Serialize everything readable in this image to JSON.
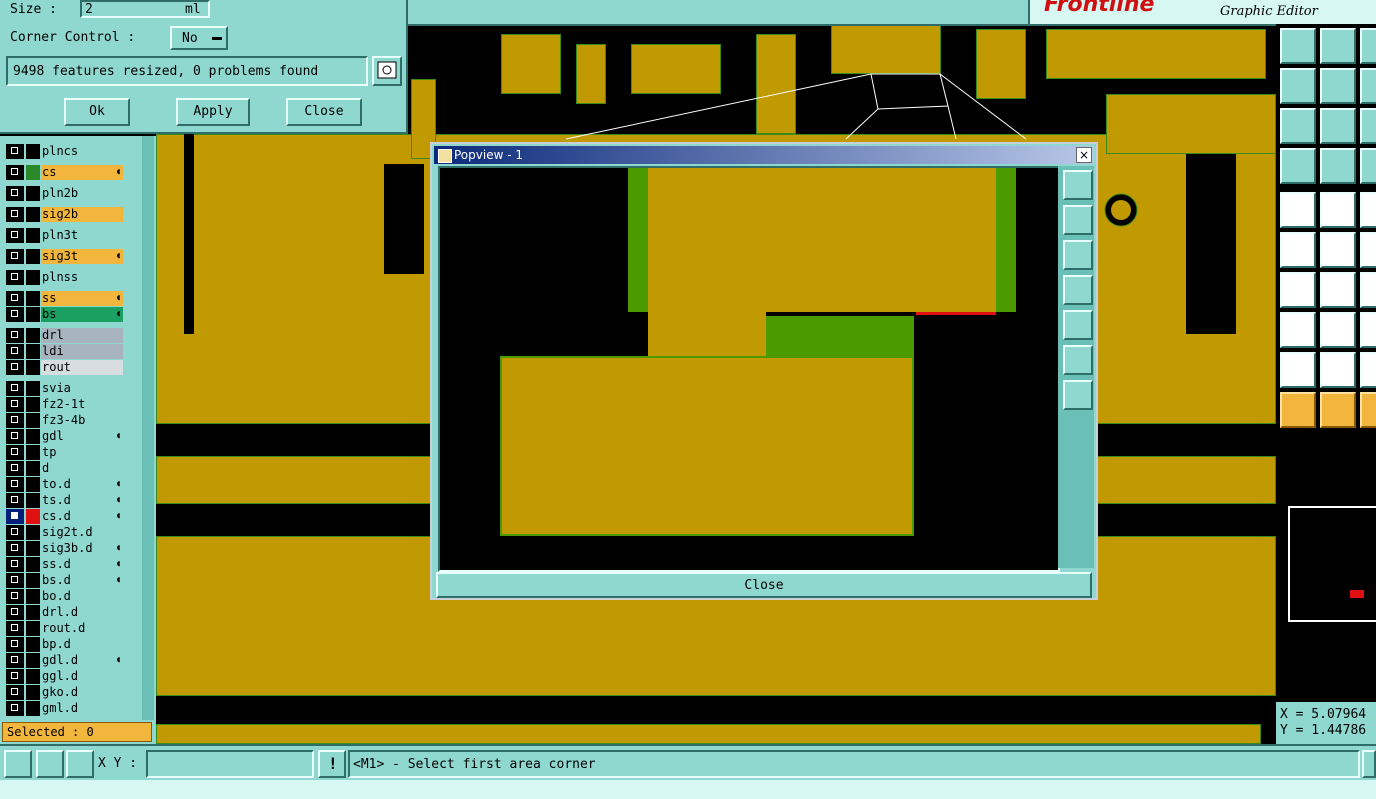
{
  "dialog": {
    "size_label": "Size :",
    "size_value": "2",
    "size_unit": "ml",
    "corner_label": "Corner Control :",
    "corner_value": "No",
    "status": "9498 features resized, 0 problems found",
    "ok": "Ok",
    "apply": "Apply",
    "close": "Close"
  },
  "topbar": {
    "brand": "Frontline",
    "subtitle": "Graphic Editor"
  },
  "layers": [
    {
      "name": "plncs",
      "style": "",
      "lock": false
    },
    {
      "name": "cs",
      "style": "orange",
      "lock": true,
      "color": "#2a8a2a"
    },
    {
      "name": "pln2b",
      "style": "",
      "lock": false
    },
    {
      "name": "sig2b",
      "style": "orange",
      "lock": false
    },
    {
      "name": "pln3t",
      "style": "",
      "lock": false
    },
    {
      "name": "sig3t",
      "style": "orange",
      "lock": true
    },
    {
      "name": "plnss",
      "style": "",
      "lock": false
    },
    {
      "name": "ss",
      "style": "orange",
      "lock": true
    },
    {
      "name": "bs",
      "style": "green",
      "lock": true
    },
    {
      "name": "drl",
      "style": "gray",
      "lock": false
    },
    {
      "name": "ldi",
      "style": "gray",
      "lock": false
    },
    {
      "name": "rout",
      "style": "light",
      "lock": false
    },
    {
      "name": "svia",
      "style": "",
      "lock": false
    },
    {
      "name": "fz2-1t",
      "style": "",
      "lock": false
    },
    {
      "name": "fz3-4b",
      "style": "",
      "lock": false
    },
    {
      "name": "gdl",
      "style": "",
      "lock": true
    },
    {
      "name": "tp",
      "style": "",
      "lock": false
    },
    {
      "name": "d",
      "style": "",
      "lock": false
    },
    {
      "name": "to.d",
      "style": "",
      "lock": true
    },
    {
      "name": "ts.d",
      "style": "",
      "lock": true
    },
    {
      "name": "cs.d",
      "style": "",
      "lock": true,
      "selected": true,
      "color": "#e01010"
    },
    {
      "name": "sig2t.d",
      "style": "",
      "lock": false
    },
    {
      "name": "sig3b.d",
      "style": "",
      "lock": true
    },
    {
      "name": "ss.d",
      "style": "",
      "lock": true
    },
    {
      "name": "bs.d",
      "style": "",
      "lock": true
    },
    {
      "name": "bo.d",
      "style": "",
      "lock": false
    },
    {
      "name": "drl.d",
      "style": "",
      "lock": false
    },
    {
      "name": "rout.d",
      "style": "",
      "lock": false
    },
    {
      "name": "bp.d",
      "style": "",
      "lock": false
    },
    {
      "name": "gdl.d",
      "style": "",
      "lock": true
    },
    {
      "name": "ggl.d",
      "style": "",
      "lock": false
    },
    {
      "name": "gko.d",
      "style": "",
      "lock": false
    },
    {
      "name": "gml.d",
      "style": "",
      "lock": false
    }
  ],
  "selected_label": "Selected : 0",
  "popview": {
    "title": "Popview - 1",
    "close": "Close"
  },
  "coords": {
    "x": "X = 5.07964",
    "y": "Y = 1.44786"
  },
  "bottom": {
    "xy_label": "X Y :",
    "xy_value": "",
    "prompt": "<M1> - Select first area corner"
  },
  "colors": {
    "panel": "#8fd8d0",
    "copper": "#c09a00",
    "accent_orange": "#f2b63c",
    "highlight_green": "#4a9a00",
    "error_red": "#e01010"
  }
}
